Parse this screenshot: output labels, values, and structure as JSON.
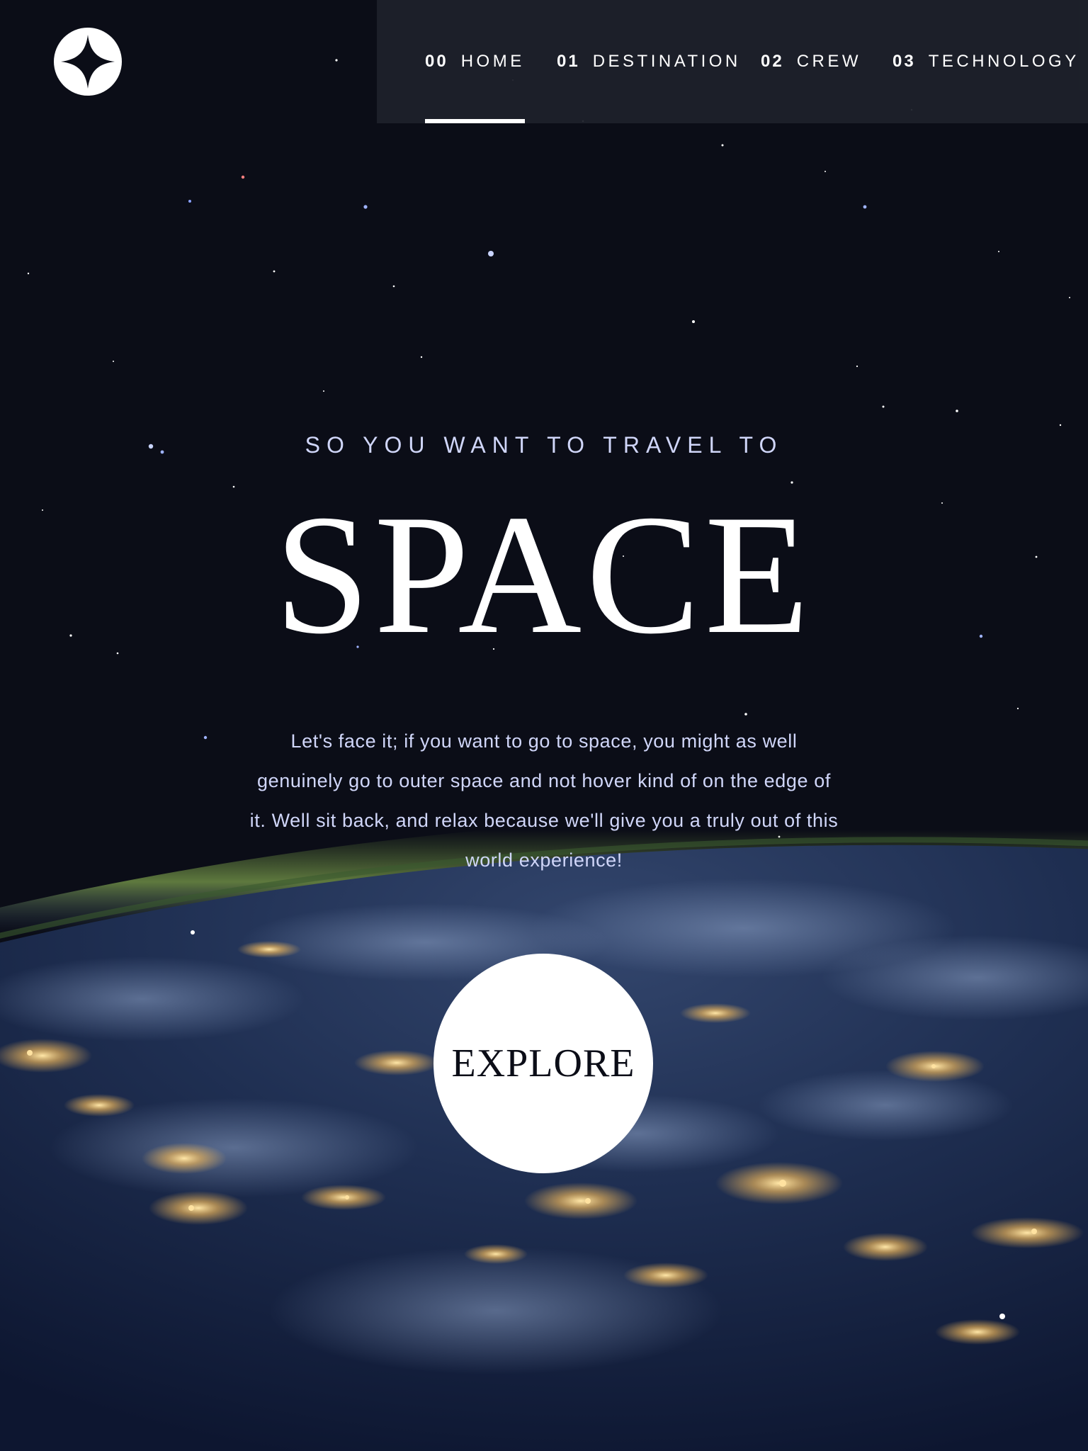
{
  "colors": {
    "background": "#0b0d17",
    "nav_background": "#1e212a",
    "text_light": "#d0d6f9",
    "text_white": "#ffffff"
  },
  "header": {
    "logo_icon": "four-point-star-icon",
    "nav": [
      {
        "number": "00",
        "label": "HOME",
        "active": true
      },
      {
        "number": "01",
        "label": "DESTINATION",
        "active": false
      },
      {
        "number": "02",
        "label": "CREW",
        "active": false
      },
      {
        "number": "03",
        "label": "TECHNOLOGY",
        "active": false
      }
    ]
  },
  "hero": {
    "eyebrow": "SO YOU WANT TO TRAVEL TO",
    "title": "SPACE",
    "body": "Let's face it; if you want to go to space, you might as well genuinely go to outer space and not hover kind of on the edge of it. Well sit back, and relax because we'll give you a truly out of this world experience!",
    "cta_label": "EXPLORE"
  }
}
